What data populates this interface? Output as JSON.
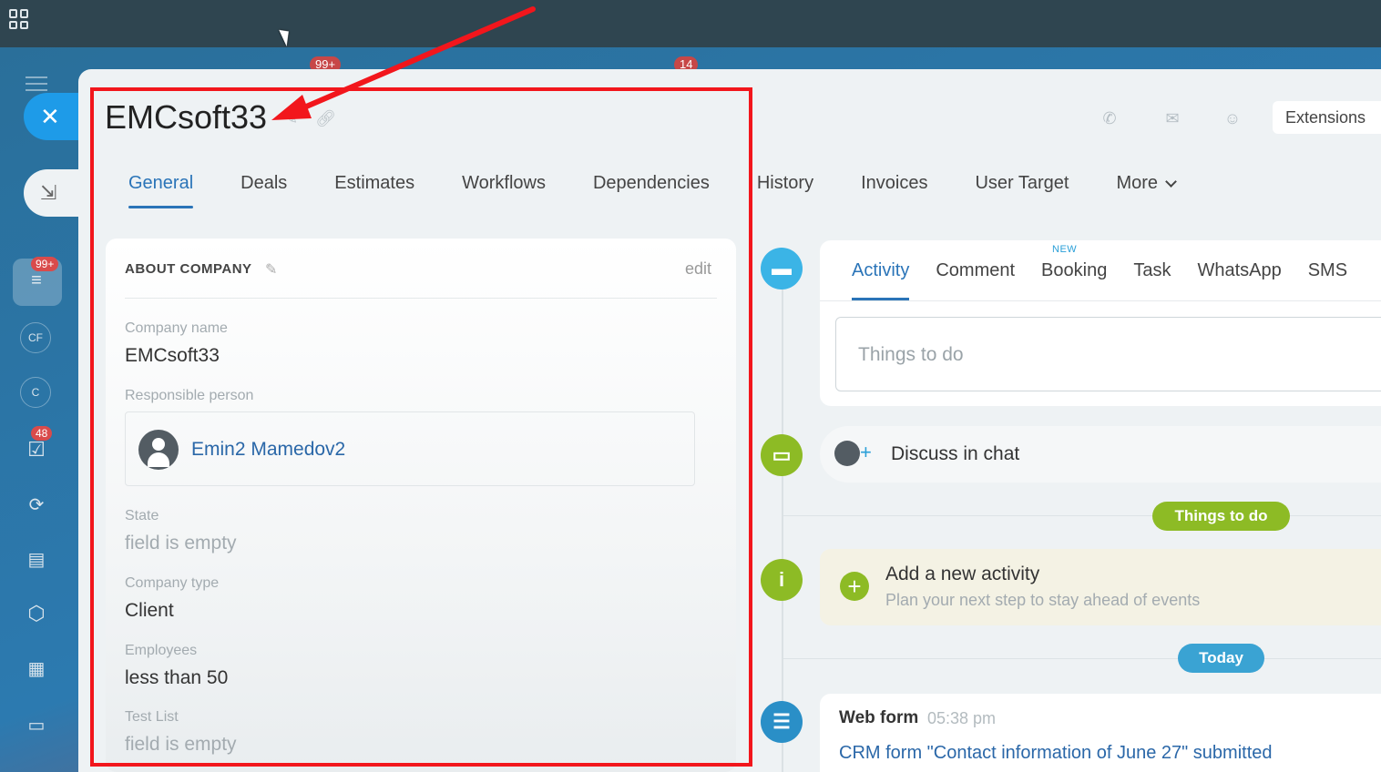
{
  "rail": {
    "badges": {
      "filter": "99+",
      "tasks": "48"
    },
    "avatars": [
      "CF",
      "C"
    ]
  },
  "background_badges": [
    "99+",
    "14"
  ],
  "entity": {
    "title": "EMCsoft33"
  },
  "header_actions": {
    "extensions_label": "Extensions"
  },
  "tabs": [
    {
      "label": "General",
      "active": true
    },
    {
      "label": "Deals"
    },
    {
      "label": "Estimates"
    },
    {
      "label": "Workflows"
    },
    {
      "label": "Dependencies"
    },
    {
      "label": "History"
    },
    {
      "label": "Invoices"
    },
    {
      "label": "User Target"
    },
    {
      "label": "More"
    }
  ],
  "about": {
    "title": "ABOUT COMPANY",
    "edit_label": "edit",
    "fields": {
      "company_name": {
        "label": "Company name",
        "value": "EMCsoft33"
      },
      "responsible": {
        "label": "Responsible person",
        "value": "Emin2 Mamedov2"
      },
      "state": {
        "label": "State",
        "value": "field is empty"
      },
      "company_type": {
        "label": "Company type",
        "value": "Client"
      },
      "employees": {
        "label": "Employees",
        "value": "less than 50"
      },
      "test_list": {
        "label": "Test List",
        "value": "field is empty"
      }
    }
  },
  "timeline": {
    "new_badge": "NEW",
    "tabs": [
      {
        "label": "Activity",
        "active": true
      },
      {
        "label": "Comment"
      },
      {
        "label": "Booking"
      },
      {
        "label": "Task"
      },
      {
        "label": "WhatsApp"
      },
      {
        "label": "SMS"
      }
    ],
    "input_placeholder": "Things to do",
    "discuss_label": "Discuss in chat",
    "things_to_do_pill": "Things to do",
    "new_activity": {
      "title": "Add a new activity",
      "subtitle": "Plan your next step to stay ahead of events"
    },
    "today_pill": "Today",
    "web_form": {
      "title": "Web form",
      "time": "05:38 pm",
      "text": "CRM form \"Contact information of June 27\" submitted"
    }
  },
  "colors": {
    "accent": "#2a74b8",
    "highlight": "#f2161c",
    "things_to_do": "#8dbb25",
    "today": "#3aa3d3"
  }
}
